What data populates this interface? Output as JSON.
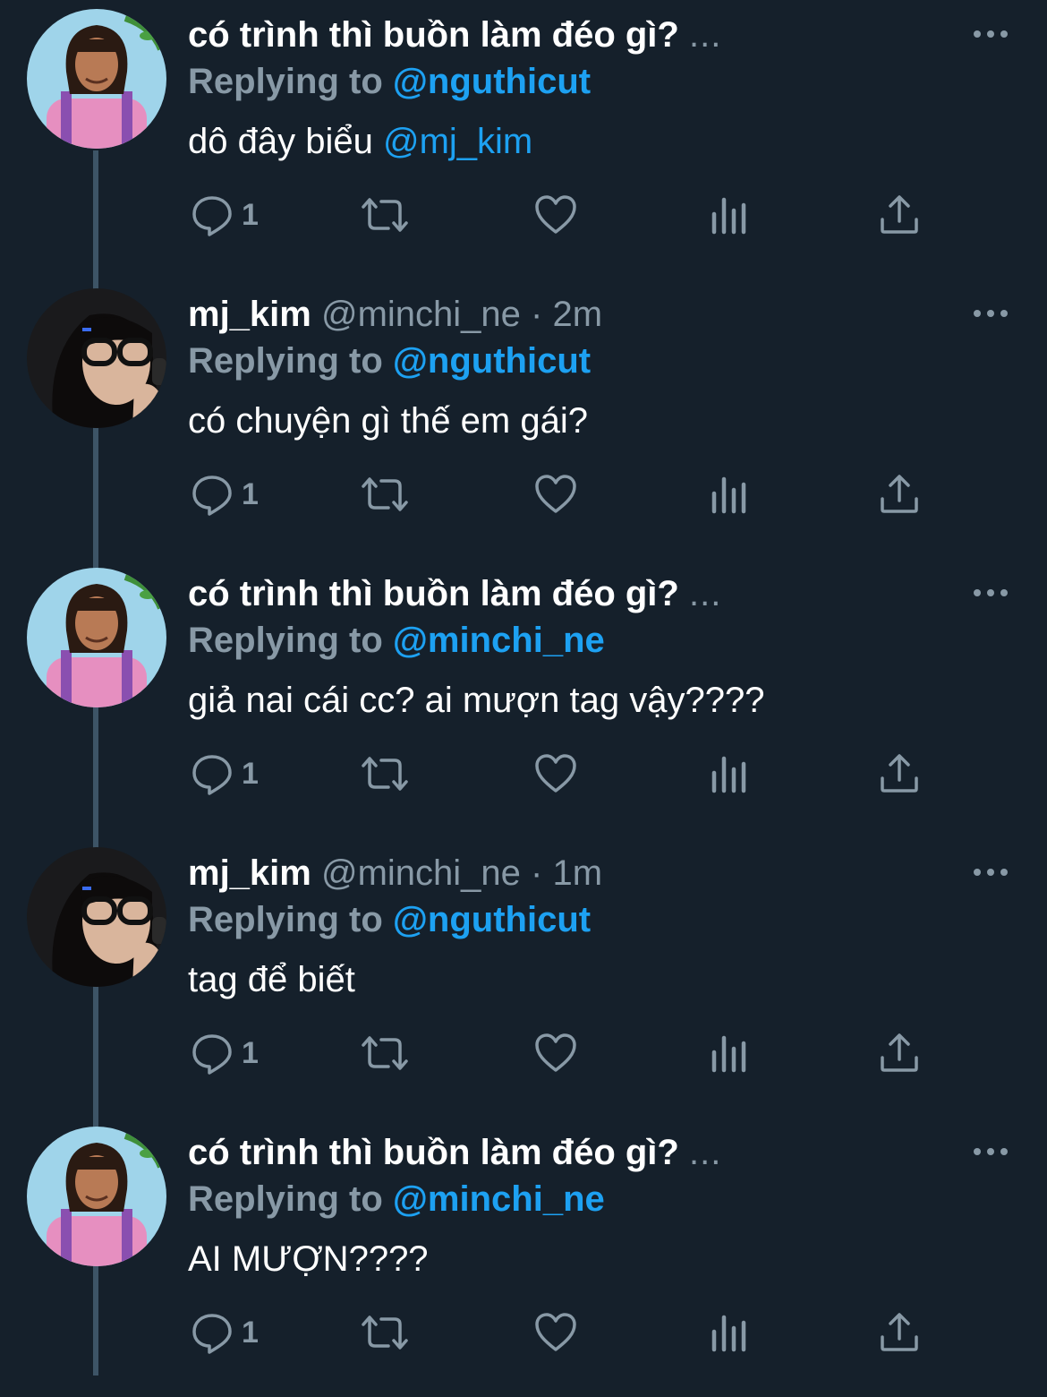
{
  "colors": {
    "background": "#15202b",
    "text": "#ffffff",
    "muted": "#8899a6",
    "link": "#1da1f2",
    "thread_line": "#3d5466"
  },
  "icons": {
    "reply": "speech-bubble-icon",
    "retweet": "retweet-icon",
    "like": "heart-icon",
    "analytics": "bar-chart-icon",
    "share": "share-icon",
    "more": "more-dots-icon"
  },
  "tweets": [
    {
      "name": "có trình thì buồn làm đéo gì?",
      "handle_time": "",
      "ellipsis": "...",
      "replying_prefix": "Replying to",
      "replying_handle": "@nguthicut",
      "text": "dô đây biểu",
      "text_mention": "@mj_kim",
      "reply_count": "1",
      "avatar": "man-avatar"
    },
    {
      "name": "mj_kim",
      "handle_time": "@minchi_ne · 2m",
      "ellipsis": "",
      "replying_prefix": "Replying to",
      "replying_handle": "@nguthicut",
      "text": "có chuyện gì thế em gái?",
      "text_mention": "",
      "reply_count": "1",
      "avatar": "girl-avatar"
    },
    {
      "name": "có trình thì buồn làm đéo gì?",
      "handle_time": "",
      "ellipsis": "...",
      "replying_prefix": "Replying to",
      "replying_handle": "@minchi_ne",
      "text": "giả nai cái cc? ai mượn tag vậy????",
      "text_mention": "",
      "reply_count": "1",
      "avatar": "man-avatar"
    },
    {
      "name": "mj_kim",
      "handle_time": "@minchi_ne · 1m",
      "ellipsis": "",
      "replying_prefix": "Replying to",
      "replying_handle": "@nguthicut",
      "text": "tag để biết",
      "text_mention": "",
      "reply_count": "1",
      "avatar": "girl-avatar"
    },
    {
      "name": "có trình thì buồn làm đéo gì?",
      "handle_time": "",
      "ellipsis": "...",
      "replying_prefix": "Replying to",
      "replying_handle": "@minchi_ne",
      "text": "AI MƯỢN????",
      "text_mention": "",
      "reply_count": "1",
      "avatar": "man-avatar"
    }
  ]
}
